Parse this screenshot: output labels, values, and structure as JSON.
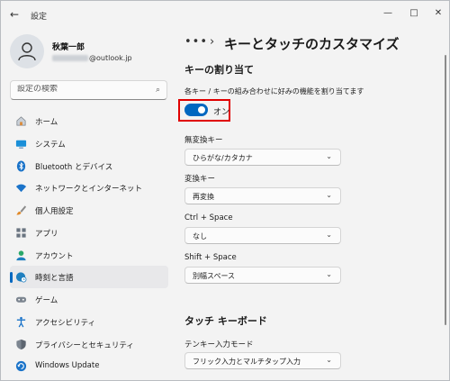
{
  "window": {
    "title": "設定",
    "back_icon": "arrow-left-icon",
    "controls": {
      "minimize": "—",
      "maximize": "□",
      "close": "✕"
    }
  },
  "account": {
    "name": "秋葉一郎",
    "email_suffix": "@outlook.jp"
  },
  "search": {
    "placeholder": "設定の検索",
    "icon": "search-icon"
  },
  "sidebar": {
    "items": [
      {
        "label": "ホーム",
        "icon": "home-icon",
        "active": false
      },
      {
        "label": "システム",
        "icon": "monitor-icon",
        "active": false
      },
      {
        "label": "Bluetooth とデバイス",
        "icon": "bluetooth-icon",
        "active": false
      },
      {
        "label": "ネットワークとインターネット",
        "icon": "wifi-icon",
        "active": false
      },
      {
        "label": "個人用設定",
        "icon": "brush-icon",
        "active": false
      },
      {
        "label": "アプリ",
        "icon": "apps-icon",
        "active": false
      },
      {
        "label": "アカウント",
        "icon": "person-icon",
        "active": false
      },
      {
        "label": "時刻と言語",
        "icon": "globe-clock-icon",
        "active": true
      },
      {
        "label": "ゲーム",
        "icon": "gamepad-icon",
        "active": false
      },
      {
        "label": "アクセシビリティ",
        "icon": "accessibility-icon",
        "active": false
      },
      {
        "label": "プライバシーとセキュリティ",
        "icon": "shield-icon",
        "active": false
      },
      {
        "label": "Windows Update",
        "icon": "update-icon",
        "active": false
      }
    ]
  },
  "breadcrumb": {
    "more": "•••",
    "separator": "›"
  },
  "page": {
    "title": "キーとタッチのカスタマイズ",
    "key_assign": {
      "heading": "キーの割り当て",
      "description": "各キー / キーの組み合わせに好みの機能を割り当てます",
      "toggle_label": "オン",
      "toggle_on": true,
      "fields": [
        {
          "label": "無変換キー",
          "value": "ひらがな/カタカナ"
        },
        {
          "label": "変換キー",
          "value": "再変換"
        },
        {
          "label": "Ctrl + Space",
          "value": "なし"
        },
        {
          "label": "Shift + Space",
          "value": "別幅スペース"
        }
      ]
    },
    "touch_keyboard": {
      "heading": "タッチ キーボード",
      "fields": [
        {
          "label": "テンキー入力モード",
          "value": "フリック入力とマルチタップ入力"
        }
      ]
    }
  },
  "colors": {
    "accent": "#0067c0",
    "highlight_box": "#e00000"
  }
}
